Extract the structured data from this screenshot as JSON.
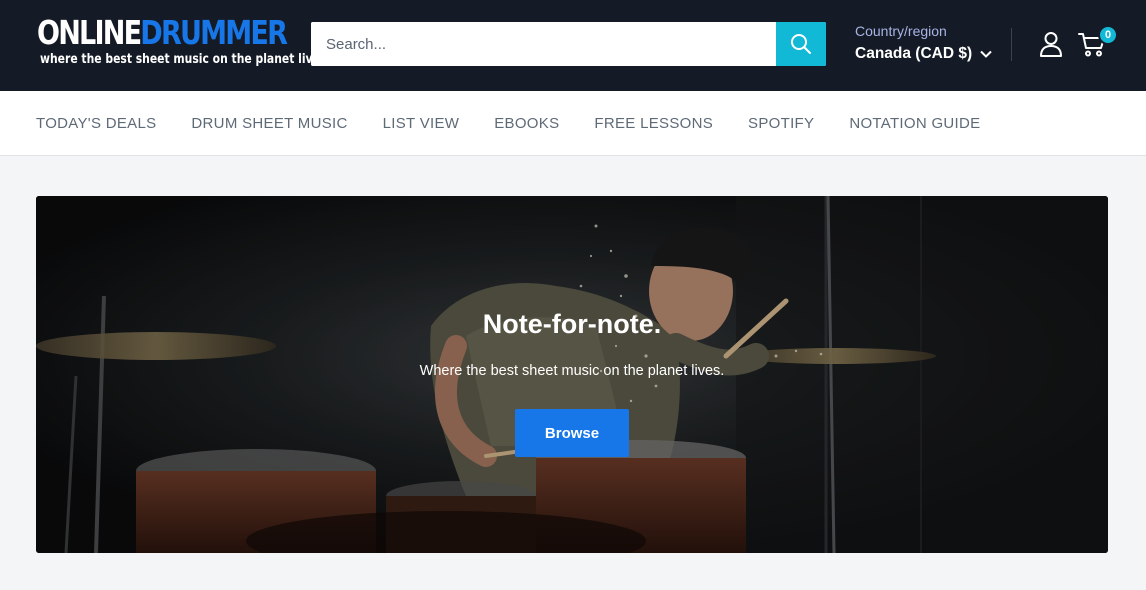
{
  "header": {
    "logo": {
      "word1": "ONLINE",
      "word2": "DRUMMER",
      "tagline": "where the best sheet music on the planet lives"
    },
    "search": {
      "placeholder": "Search...",
      "icon": "search-icon"
    },
    "country": {
      "label": "Country/region",
      "selected": "Canada (CAD $)"
    },
    "account_icon": "user-icon",
    "cart": {
      "icon": "cart-icon",
      "count": "0"
    }
  },
  "nav": {
    "items": [
      {
        "label": "TODAY'S DEALS"
      },
      {
        "label": "DRUM SHEET MUSIC"
      },
      {
        "label": "LIST VIEW"
      },
      {
        "label": "EBOOKS"
      },
      {
        "label": "FREE LESSONS"
      },
      {
        "label": "SPOTIFY"
      },
      {
        "label": "NOTATION GUIDE"
      }
    ]
  },
  "hero": {
    "title": "Note-for-note.",
    "subtitle": "Where the best sheet music on the planet lives.",
    "button_label": "Browse"
  },
  "colors": {
    "header_bg": "#151b26",
    "accent_cyan": "#12b9d6",
    "brand_blue": "#1877e8",
    "country_label": "#a7b4e4",
    "page_bg": "#f3f5f6"
  }
}
